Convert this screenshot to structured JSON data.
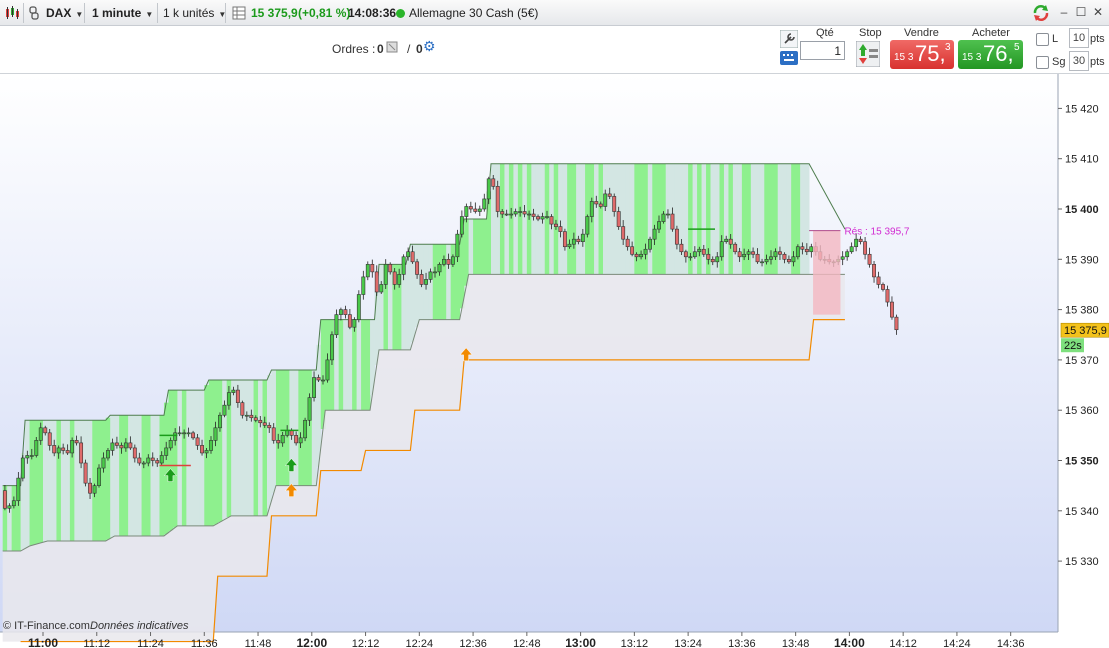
{
  "toolbar": {
    "instrument": "DAX",
    "timeframe": "1 minute",
    "units": "1 k unités",
    "price": "15 375,9",
    "change": "(+0,81 %)",
    "time": "14:08:36",
    "market": "Allemagne 30 Cash (5€)",
    "colors": {
      "up": "#1b9a1b",
      "market_dot": "#2ab52a"
    }
  },
  "orders": {
    "label": "Ordres :",
    "buy_count": "0",
    "sell_count": "0",
    "slash": "/"
  },
  "trade": {
    "qty_label": "Qté",
    "qty_value": "1",
    "stop_label": "Stop",
    "sell_label": "Vendre",
    "sell_small": "15 3",
    "sell_big": "75,",
    "sell_sup": "3",
    "buy_label": "Acheter",
    "buy_small": "15 3",
    "buy_big": "76,",
    "buy_sup": "5",
    "l_label": "L",
    "l_value": "10",
    "sg_label": "Sg",
    "sg_value": "30",
    "pts": "pts",
    "colors": {
      "sell": "#e0403d",
      "buy": "#2eaa2e"
    }
  },
  "chart_data": {
    "type": "candlestick",
    "footer": "© IT-Finance.com",
    "footer_note": "Données indicatives",
    "last_price": "15 375,9",
    "countdown": "22s",
    "resistance_label": "Rés : 15 395,7",
    "ylim": [
      15320,
      15426
    ],
    "y_ticks": [
      {
        "v": 15330,
        "label": "15 330",
        "bold": false
      },
      {
        "v": 15340,
        "label": "15 340",
        "bold": false
      },
      {
        "v": 15350,
        "label": "15 350",
        "bold": true
      },
      {
        "v": 15360,
        "label": "15 360",
        "bold": false
      },
      {
        "v": 15370,
        "label": "15 370",
        "bold": false
      },
      {
        "v": 15380,
        "label": "15 380",
        "bold": false
      },
      {
        "v": 15390,
        "label": "15 390",
        "bold": false
      },
      {
        "v": 15400,
        "label": "15 400",
        "bold": true
      },
      {
        "v": 15410,
        "label": "15 410",
        "bold": false
      },
      {
        "v": 15420,
        "label": "15 420",
        "bold": false
      }
    ],
    "x_ticks": [
      {
        "m": 660,
        "label": "11:00",
        "bold": true
      },
      {
        "m": 672,
        "label": "11:12",
        "bold": false
      },
      {
        "m": 684,
        "label": "11:24",
        "bold": false
      },
      {
        "m": 696,
        "label": "11:36",
        "bold": false
      },
      {
        "m": 708,
        "label": "11:48",
        "bold": false
      },
      {
        "m": 720,
        "label": "12:00",
        "bold": true
      },
      {
        "m": 732,
        "label": "12:12",
        "bold": false
      },
      {
        "m": 744,
        "label": "12:24",
        "bold": false
      },
      {
        "m": 756,
        "label": "12:36",
        "bold": false
      },
      {
        "m": 768,
        "label": "12:48",
        "bold": false
      },
      {
        "m": 780,
        "label": "13:00",
        "bold": true
      },
      {
        "m": 792,
        "label": "13:12",
        "bold": false
      },
      {
        "m": 804,
        "label": "13:24",
        "bold": false
      },
      {
        "m": 816,
        "label": "13:36",
        "bold": false
      },
      {
        "m": 828,
        "label": "13:48",
        "bold": false
      },
      {
        "m": 840,
        "label": "14:00",
        "bold": true
      },
      {
        "m": 852,
        "label": "14:12",
        "bold": false
      },
      {
        "m": 864,
        "label": "14:24",
        "bold": false
      },
      {
        "m": 876,
        "label": "14:36",
        "bold": false
      }
    ],
    "close_path": [
      [
        650.5,
        15344
      ],
      [
        651,
        15339
      ],
      [
        652,
        15342
      ],
      [
        653,
        15340
      ],
      [
        654,
        15344
      ],
      [
        655,
        15349
      ],
      [
        656,
        15352
      ],
      [
        657,
        15350
      ],
      [
        658,
        15352
      ],
      [
        659,
        15356
      ],
      [
        660,
        15357
      ],
      [
        661,
        15354
      ],
      [
        662,
        15352
      ],
      [
        663,
        15351
      ],
      [
        664,
        15354
      ],
      [
        665,
        15350
      ],
      [
        666,
        15353
      ],
      [
        667,
        15355
      ],
      [
        668,
        15352
      ],
      [
        669,
        15347
      ],
      [
        670,
        15344
      ],
      [
        671,
        15343
      ],
      [
        672,
        15347
      ],
      [
        673,
        15350
      ],
      [
        674,
        15351
      ],
      [
        675,
        15353
      ],
      [
        676,
        15354
      ],
      [
        677,
        15352
      ],
      [
        678,
        15353
      ],
      [
        679,
        15354
      ],
      [
        680,
        15351
      ],
      [
        681,
        15350
      ],
      [
        682,
        15349
      ],
      [
        683,
        15350
      ],
      [
        684,
        15351
      ],
      [
        685,
        15349
      ],
      [
        686,
        15350
      ],
      [
        687,
        15352
      ],
      [
        688,
        15353
      ],
      [
        689,
        15355
      ],
      [
        690,
        15356
      ],
      [
        691,
        15355
      ],
      [
        692,
        15356
      ],
      [
        693,
        15355
      ],
      [
        694,
        15354
      ],
      [
        695,
        15352
      ],
      [
        696,
        15351
      ],
      [
        697,
        15353
      ],
      [
        698,
        15355
      ],
      [
        699,
        15358
      ],
      [
        700,
        15360
      ],
      [
        701,
        15362
      ],
      [
        702,
        15365
      ],
      [
        703,
        15363
      ],
      [
        704,
        15360
      ],
      [
        705,
        15358
      ],
      [
        706,
        15360
      ],
      [
        707,
        15357
      ],
      [
        708,
        15359
      ],
      [
        709,
        15356
      ],
      [
        710,
        15358
      ],
      [
        711,
        15355
      ],
      [
        712,
        15353
      ],
      [
        713,
        15354
      ],
      [
        714,
        15356
      ],
      [
        715,
        15356
      ],
      [
        716,
        15354
      ],
      [
        717,
        15353
      ],
      [
        718,
        15356
      ],
      [
        719,
        15360
      ],
      [
        720,
        15365
      ],
      [
        721,
        15368
      ],
      [
        722,
        15364
      ],
      [
        723,
        15368
      ],
      [
        724,
        15372
      ],
      [
        725,
        15378
      ],
      [
        726,
        15380
      ],
      [
        727,
        15380
      ],
      [
        728,
        15378
      ],
      [
        729,
        15375
      ],
      [
        730,
        15381
      ],
      [
        731,
        15385
      ],
      [
        732,
        15388
      ],
      [
        733,
        15390
      ],
      [
        734,
        15385
      ],
      [
        735,
        15382
      ],
      [
        736,
        15388
      ],
      [
        737,
        15390
      ],
      [
        738,
        15385
      ],
      [
        739,
        15385
      ],
      [
        740,
        15389
      ],
      [
        741,
        15392
      ],
      [
        742,
        15391
      ],
      [
        743,
        15388
      ],
      [
        744,
        15386
      ],
      [
        745,
        15384
      ],
      [
        746,
        15388
      ],
      [
        747,
        15387
      ],
      [
        748,
        15388
      ],
      [
        749,
        15390
      ],
      [
        750,
        15390
      ],
      [
        751,
        15388
      ],
      [
        752,
        15393
      ],
      [
        753,
        15397
      ],
      [
        754,
        15400
      ],
      [
        755,
        15401
      ],
      [
        756,
        15399
      ],
      [
        757,
        15400
      ],
      [
        758,
        15400
      ],
      [
        759,
        15404
      ],
      [
        760,
        15408
      ],
      [
        761,
        15401
      ],
      [
        762,
        15398
      ],
      [
        763,
        15400
      ],
      [
        764,
        15398
      ],
      [
        765,
        15400
      ],
      [
        766,
        15399
      ],
      [
        767,
        15400
      ],
      [
        768,
        15398
      ],
      [
        769,
        15400
      ],
      [
        770,
        15397
      ],
      [
        771,
        15399
      ],
      [
        772,
        15398
      ],
      [
        773,
        15399
      ],
      [
        774,
        15395
      ],
      [
        775,
        15398
      ],
      [
        776,
        15393
      ],
      [
        777,
        15392
      ],
      [
        778,
        15394
      ],
      [
        779,
        15394
      ],
      [
        780,
        15393
      ],
      [
        781,
        15397
      ],
      [
        782,
        15400
      ],
      [
        783,
        15403
      ],
      [
        784,
        15399
      ],
      [
        785,
        15402
      ],
      [
        786,
        15404
      ],
      [
        787,
        15401
      ],
      [
        788,
        15398
      ],
      [
        789,
        15395
      ],
      [
        790,
        15393
      ],
      [
        791,
        15392
      ],
      [
        792,
        15390
      ],
      [
        793,
        15391
      ],
      [
        794,
        15391
      ],
      [
        795,
        15393
      ],
      [
        796,
        15395
      ],
      [
        797,
        15397
      ],
      [
        798,
        15398
      ],
      [
        799,
        15400
      ],
      [
        800,
        15398
      ],
      [
        801,
        15394
      ],
      [
        802,
        15392
      ],
      [
        803,
        15391
      ],
      [
        804,
        15390
      ],
      [
        805,
        15391
      ],
      [
        806,
        15392
      ],
      [
        807,
        15392
      ],
      [
        808,
        15390
      ],
      [
        809,
        15390
      ],
      [
        810,
        15389
      ],
      [
        811,
        15392
      ],
      [
        812,
        15395
      ],
      [
        813,
        15393
      ],
      [
        814,
        15393
      ],
      [
        815,
        15390
      ],
      [
        816,
        15391
      ],
      [
        817,
        15391
      ],
      [
        818,
        15392
      ],
      [
        819,
        15390
      ],
      [
        820,
        15389
      ],
      [
        821,
        15390
      ],
      [
        822,
        15390
      ],
      [
        823,
        15391
      ],
      [
        824,
        15392
      ],
      [
        825,
        15390
      ],
      [
        826,
        15390
      ],
      [
        827,
        15389
      ],
      [
        828,
        15392
      ],
      [
        829,
        15393
      ],
      [
        830,
        15391
      ],
      [
        831,
        15392
      ],
      [
        832,
        15393
      ],
      [
        833,
        15390
      ],
      [
        834,
        15390
      ],
      [
        835,
        15390
      ],
      [
        836,
        15389
      ],
      [
        837,
        15390
      ],
      [
        838,
        15390
      ],
      [
        839,
        15391
      ],
      [
        840,
        15392
      ],
      [
        841,
        15393
      ],
      [
        842,
        15395
      ],
      [
        843,
        15392
      ],
      [
        844,
        15390
      ],
      [
        845,
        15388
      ],
      [
        846,
        15385
      ],
      [
        847,
        15385
      ],
      [
        848,
        15383
      ],
      [
        849,
        15380
      ],
      [
        850,
        15377
      ],
      [
        850.5,
        15376
      ]
    ],
    "channel_upper": [
      [
        651,
        15345
      ],
      [
        653,
        15345
      ],
      [
        655,
        15345
      ],
      [
        656,
        15358
      ],
      [
        667,
        15358
      ],
      [
        668,
        15358
      ],
      [
        674,
        15358
      ],
      [
        675,
        15359
      ],
      [
        687,
        15359
      ],
      [
        688,
        15364
      ],
      [
        696,
        15364
      ],
      [
        697,
        15366
      ],
      [
        710,
        15366
      ],
      [
        711,
        15368
      ],
      [
        721,
        15368
      ],
      [
        722,
        15378
      ],
      [
        734,
        15378
      ],
      [
        735,
        15389
      ],
      [
        741,
        15389
      ],
      [
        742,
        15393
      ],
      [
        753,
        15393
      ],
      [
        754,
        15398
      ],
      [
        759,
        15398
      ],
      [
        760,
        15409
      ],
      [
        831,
        15409
      ]
    ],
    "channel_lower": [
      [
        651,
        15332
      ],
      [
        655,
        15332
      ],
      [
        657,
        15333
      ],
      [
        661,
        15334
      ],
      [
        674,
        15334
      ],
      [
        676,
        15335
      ],
      [
        687,
        15335
      ],
      [
        690,
        15337
      ],
      [
        698,
        15337
      ],
      [
        702,
        15339
      ],
      [
        710,
        15339
      ],
      [
        712,
        15345
      ],
      [
        721,
        15345
      ],
      [
        723,
        15360
      ],
      [
        733,
        15360
      ],
      [
        735,
        15372
      ],
      [
        742,
        15372
      ],
      [
        744,
        15378
      ],
      [
        753,
        15378
      ],
      [
        755,
        15387
      ],
      [
        831,
        15387
      ]
    ],
    "stop_line": [
      [
        655,
        15314
      ],
      [
        698,
        15314
      ],
      [
        699,
        15327
      ],
      [
        710,
        15327
      ],
      [
        711,
        15339
      ],
      [
        721,
        15339
      ],
      [
        722,
        15348
      ],
      [
        731,
        15348
      ],
      [
        732,
        15352
      ],
      [
        742,
        15352
      ],
      [
        743,
        15360
      ],
      [
        753,
        15360
      ],
      [
        754,
        15370
      ],
      [
        831,
        15370
      ],
      [
        832,
        15378
      ],
      [
        839,
        15378
      ]
    ],
    "signals_up": [
      {
        "m": 688,
        "v": 15347,
        "color": "#1a9c1a"
      },
      {
        "m": 715,
        "v": 15349,
        "color": "#1a9c1a"
      },
      {
        "m": 715,
        "v": 15344,
        "color": "#f28a00"
      },
      {
        "m": 754,
        "v": 15371,
        "color": "#f28a00"
      }
    ],
    "resistance": {
      "from": 831,
      "to": 838,
      "value": 15395.7
    }
  }
}
